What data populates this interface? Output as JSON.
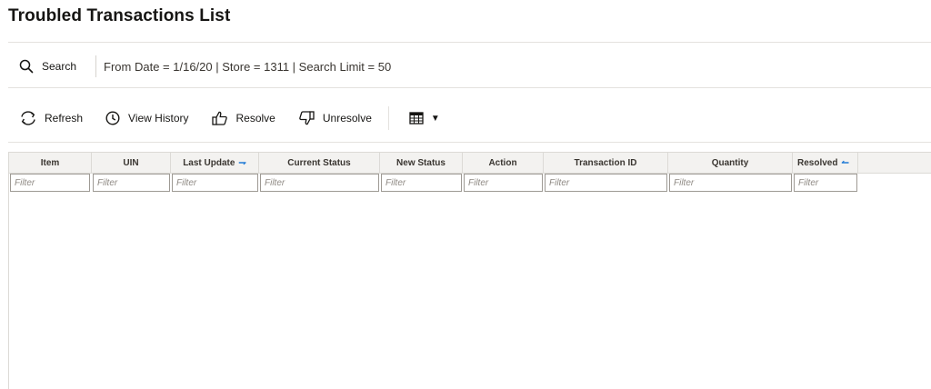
{
  "page": {
    "title": "Troubled Transactions List"
  },
  "search": {
    "button_label": "Search",
    "criteria": "From Date = 1/16/20 | Store = 1311 | Search Limit = 50"
  },
  "toolbar": {
    "refresh_label": "Refresh",
    "view_history_label": "View History",
    "resolve_label": "Resolve",
    "unresolve_label": "Unresolve"
  },
  "table": {
    "columns": [
      {
        "label": "Item"
      },
      {
        "label": "UIN"
      },
      {
        "label": "Last Update",
        "sort": "descending"
      },
      {
        "label": "Current Status"
      },
      {
        "label": "New Status"
      },
      {
        "label": "Action"
      },
      {
        "label": "Transaction ID"
      },
      {
        "label": "Quantity"
      },
      {
        "label": "Resolved",
        "sort": "ascending"
      }
    ],
    "filter_placeholder": "Filter",
    "rows": []
  },
  "colors": {
    "sort_indicator": "#227bd6",
    "header_bg": "#f3f2f0",
    "divider": "#e4e2de"
  }
}
